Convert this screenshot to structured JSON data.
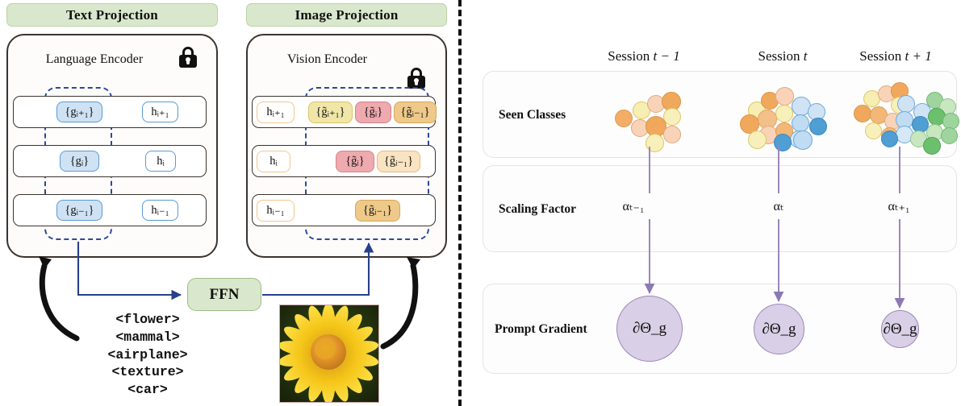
{
  "left": {
    "banners": [
      {
        "id": "text-projection",
        "label": "Text Projection"
      },
      {
        "id": "image-projection",
        "label": "Image Projection"
      }
    ],
    "encoders": [
      {
        "id": "language-encoder",
        "title": "Language Encoder",
        "lock": "lock-icon"
      },
      {
        "id": "vision-encoder",
        "title": "Vision Encoder",
        "lock": "lock-icon"
      }
    ],
    "text_rows": [
      {
        "prompt": "{gᵢ₊₁}",
        "hidden": "hᵢ₊₁"
      },
      {
        "prompt": "{gᵢ}",
        "hidden": "hᵢ"
      },
      {
        "prompt": "{gᵢ₋₁}",
        "hidden": "hᵢ₋₁"
      }
    ],
    "image_rows": [
      {
        "hidden": "hᵢ₊₁",
        "prompts": [
          "{g̃ᵢ₊₁}",
          "{g̃ᵢ}",
          "{g̃ᵢ₋₁}"
        ]
      },
      {
        "hidden": "hᵢ",
        "prompts": [
          "{g̃ᵢ}",
          "{g̃ᵢ₋₁}"
        ]
      },
      {
        "hidden": "hᵢ₋₁",
        "prompts": [
          "{g̃ᵢ₋₁}"
        ]
      }
    ],
    "ffn": {
      "label": "FFN"
    },
    "class_tokens": [
      "<flower>",
      "<mammal>",
      "<airplane>",
      "<texture>",
      "<car>"
    ],
    "image_thumbnail": {
      "name": "flower-photo",
      "alt": "yellow daisy flower"
    }
  },
  "right": {
    "sessions": [
      {
        "id": "session-prev",
        "label_prefix": "Session",
        "label_math": "t − 1"
      },
      {
        "id": "session-cur",
        "label_prefix": "Session",
        "label_math": "t"
      },
      {
        "id": "session-next",
        "label_prefix": "Session",
        "label_math": "t + 1"
      }
    ],
    "rows": [
      {
        "id": "seen-classes",
        "label": "Seen Classes"
      },
      {
        "id": "scaling-factor",
        "label": "Scaling Factor"
      },
      {
        "id": "prompt-gradient",
        "label": "Prompt Gradient"
      }
    ],
    "scaling_factors": [
      "αₜ₋₁",
      "αₜ",
      "αₜ₊₁"
    ],
    "gradients": [
      {
        "label": "∂Θ_g",
        "size": 82
      },
      {
        "label": "∂Θ_g",
        "size": 63
      },
      {
        "label": "∂Θ_g",
        "size": 47
      }
    ]
  },
  "colors": {
    "banner_green": "#d9e8cc",
    "prompt_blue": "#cfe2f3",
    "prompt_yellow": "#f0e6a8",
    "prompt_red": "#eeaaae",
    "prompt_orange": "#f7d9a6",
    "dashed_blue": "#2b4a9b",
    "gradient_purple": "#d9cfe6",
    "cluster_orange": "#f0a860",
    "cluster_blue": "#62a8dd",
    "cluster_green": "#6cbf6c"
  },
  "chart_data": {
    "type": "scatter",
    "title": "Seen Classes accumulation across sessions",
    "series": [
      {
        "name": "Session t-1",
        "orange": 9,
        "blue": 0,
        "green": 0
      },
      {
        "name": "Session t",
        "orange": 9,
        "blue": 8,
        "green": 0
      },
      {
        "name": "Session t+1",
        "orange": 9,
        "blue": 8,
        "green": 9
      }
    ],
    "gradient_magnitudes": [
      82,
      63,
      47
    ],
    "ylabel": "",
    "xlabel": "Session"
  }
}
